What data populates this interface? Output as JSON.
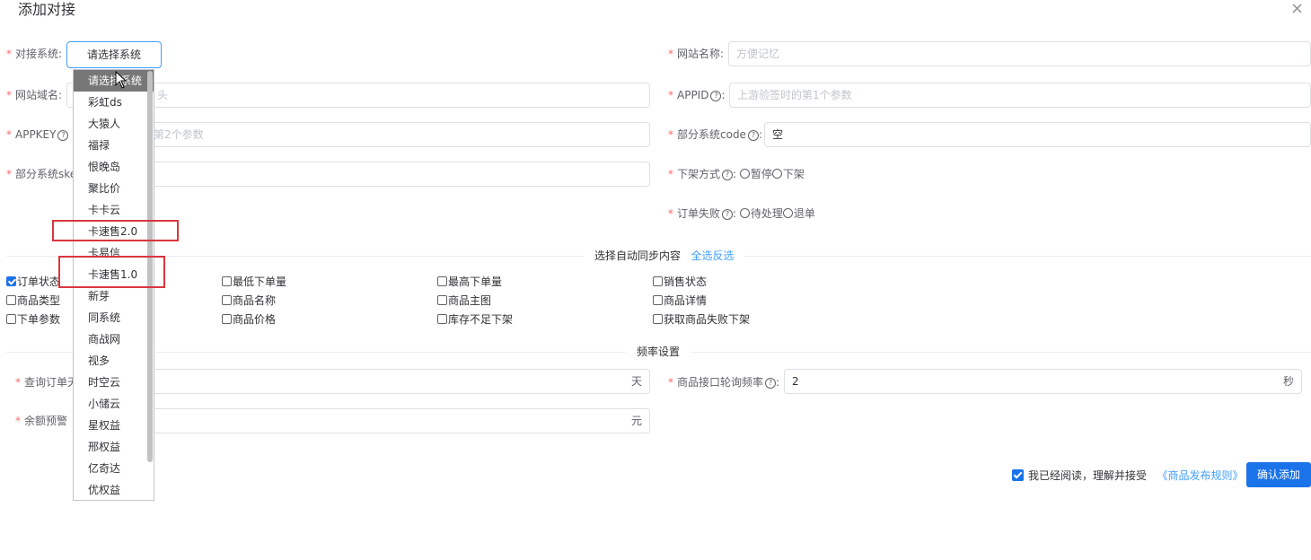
{
  "dialog": {
    "title": "添加对接",
    "close_icon": "×"
  },
  "form": {
    "system_label": "对接系统",
    "system_value": "请选择系统",
    "site_name_label": "网站名称",
    "site_name_placeholder": "方便记忆",
    "domain_label": "网站域名",
    "domain_placeholder_visible": "头",
    "appid_label": "APPID",
    "appid_placeholder": "上游验签时的第1个参数",
    "appkey_label": "APPKEY",
    "appkey_placeholder_visible": "第2个参数",
    "code_label": "部分系统code",
    "code_value": "空",
    "ske_label": "部分系统ske",
    "offshelf_label": "下架方式",
    "offshelf_options": [
      "暂停",
      "下架"
    ],
    "order_fail_label": "订单失败",
    "order_fail_options": [
      "待处理",
      "退单"
    ],
    "query_label": "查询订单天",
    "query_suffix": "天",
    "poll_label": "商品接口轮询频率",
    "poll_value": "2",
    "poll_suffix": "秒",
    "balance_label": "余额预警",
    "balance_suffix": "元",
    "colon": ":"
  },
  "dropdown": {
    "options": [
      "请选择系统",
      "彩虹ds",
      "大猿人",
      "福禄",
      "恨晚岛",
      "聚比价",
      "卡卡云",
      "卡速售2.0",
      "卡易信",
      "卡速售1.0",
      "新芽",
      "同系统",
      "商战网",
      "视多",
      "时空云",
      "小储云",
      "星权益",
      "邢权益",
      "亿奇达",
      "优权益"
    ],
    "selected_index": 0
  },
  "sync": {
    "title": "选择自动同步内容",
    "toggle_all": "全选反选",
    "items": [
      {
        "label": "订单状态",
        "checked": true
      },
      {
        "label": "最低下单量",
        "checked": false
      },
      {
        "label": "最高下单量",
        "checked": false
      },
      {
        "label": "销售状态",
        "checked": false
      },
      {
        "label": "商品类型",
        "checked": false
      },
      {
        "label": "商品名称",
        "checked": false
      },
      {
        "label": "商品主图",
        "checked": false
      },
      {
        "label": "商品详情",
        "checked": false
      },
      {
        "label": "下单参数",
        "checked": false
      },
      {
        "label": "商品价格",
        "checked": false
      },
      {
        "label": "库存不足下架",
        "checked": false
      },
      {
        "label": "获取商品失败下架",
        "checked": false
      }
    ]
  },
  "frequency": {
    "title": "频率设置"
  },
  "footer": {
    "agree_text": "我已经阅读，理解并接受",
    "rules_link": "《商品发布规则》",
    "confirm_label": "确认添加"
  },
  "colors": {
    "primary": "#1a73e8",
    "required": "#f56c6c",
    "highlight": "#d9363e"
  }
}
